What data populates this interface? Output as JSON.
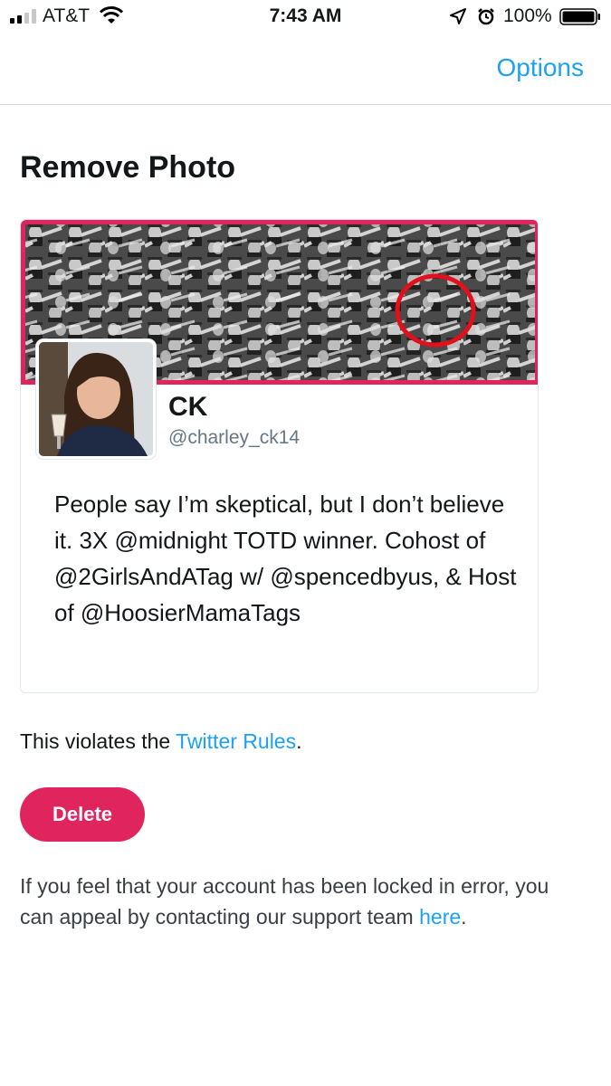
{
  "status_bar": {
    "carrier": "AT&T",
    "time": "7:43 AM",
    "battery": "100%",
    "icons": [
      "signal-icon",
      "wifi-icon",
      "location-icon",
      "alarm-icon",
      "battery-icon"
    ]
  },
  "nav": {
    "options_label": "Options"
  },
  "page": {
    "title": "Remove Photo"
  },
  "profile_card": {
    "display_name": "CK",
    "handle": "@charley_ck14",
    "bio": "People say I’m skeptical, but I don’t believe it. 3X @midnight TOTD winner. Cohost of @2GirlsAndATag w/ @spencedbyus, & Host of @HoosierMamaTags"
  },
  "violation": {
    "prefix": "This violates the ",
    "link_label": "Twitter Rules",
    "suffix": "."
  },
  "actions": {
    "delete_label": "Delete"
  },
  "appeal": {
    "text": "If you feel that your account has been locked in error, you can appeal by contacting our support team ",
    "link_label": "here",
    "suffix": "."
  },
  "colors": {
    "accent": "#1da1f2",
    "delete": "#e0245e",
    "banner_border": "#e0245e",
    "highlight_circle": "#e1101a"
  }
}
